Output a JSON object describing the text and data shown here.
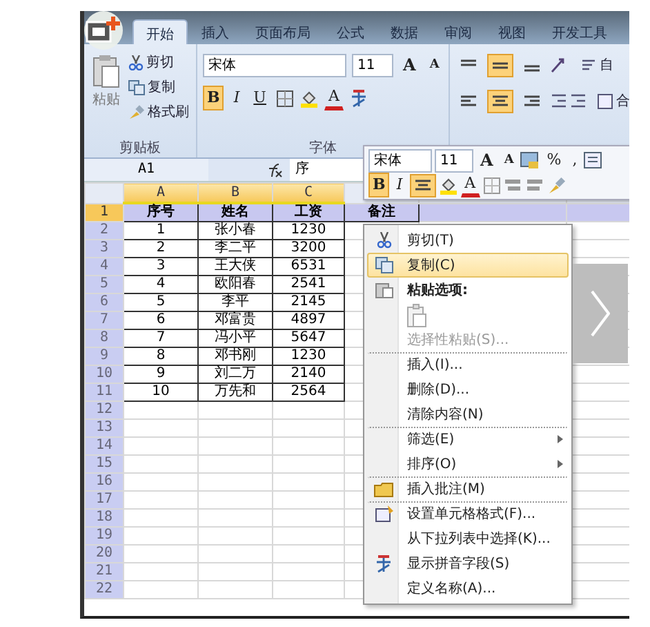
{
  "ribbon_tabs": [
    {
      "label": "开始",
      "selected": true
    },
    {
      "label": "插入",
      "selected": false
    },
    {
      "label": "页面布局",
      "selected": false
    },
    {
      "label": "公式",
      "selected": false
    },
    {
      "label": "数据",
      "selected": false
    },
    {
      "label": "审阅",
      "selected": false
    },
    {
      "label": "视图",
      "selected": false
    },
    {
      "label": "开发工具",
      "selected": false
    }
  ],
  "clipboard": {
    "paste": "粘贴",
    "cut": "剪切",
    "copy": "复制",
    "format_painter": "格式刷",
    "group_label": "剪贴板"
  },
  "font": {
    "name": "宋体",
    "size": "11",
    "grow": "A",
    "shrink": "A",
    "color_letter": "A",
    "group_label": "字体",
    "style_buttons": [
      {
        "glyph": "B",
        "selected": true
      },
      {
        "glyph": "I",
        "selected": false
      },
      {
        "glyph": "U",
        "selected": false
      }
    ]
  },
  "alignment": {
    "vertical": [
      {
        "selected": false
      },
      {
        "selected": true
      },
      {
        "selected": false
      }
    ],
    "horizontal": [
      {
        "selected": false
      },
      {
        "selected": true
      },
      {
        "selected": false
      }
    ],
    "wrap_text": "自",
    "merge": "合"
  },
  "name_box": "A1",
  "formula": "序",
  "columns": [
    {
      "label": "A",
      "selected": true
    },
    {
      "label": "B",
      "selected": true
    },
    {
      "label": "C",
      "selected": true
    }
  ],
  "rows": [
    {
      "number": "1",
      "selected": true,
      "cells": [
        "序号",
        "姓名",
        "工资",
        "备注"
      ]
    },
    {
      "number": "2",
      "selected": false,
      "cells": [
        "1",
        "张小春",
        "1230"
      ]
    },
    {
      "number": "3",
      "selected": false,
      "cells": [
        "2",
        "李二平",
        "3200"
      ]
    },
    {
      "number": "4",
      "selected": false,
      "cells": [
        "3",
        "王大侠",
        "6531"
      ]
    },
    {
      "number": "5",
      "selected": false,
      "cells": [
        "4",
        "欧阳春",
        "2541"
      ]
    },
    {
      "number": "6",
      "selected": false,
      "cells": [
        "5",
        "李平",
        "2145"
      ]
    },
    {
      "number": "7",
      "selected": false,
      "cells": [
        "6",
        "邓富贵",
        "4897"
      ]
    },
    {
      "number": "8",
      "selected": false,
      "cells": [
        "7",
        "冯小平",
        "5647"
      ]
    },
    {
      "number": "9",
      "selected": false,
      "cells": [
        "8",
        "邓书刚",
        "1230"
      ]
    },
    {
      "number": "10",
      "selected": false,
      "cells": [
        "9",
        "刘二万",
        "2140"
      ]
    },
    {
      "number": "11",
      "selected": false,
      "cells": [
        "10",
        "万先和",
        "2564"
      ]
    },
    {
      "number": "12",
      "selected": false,
      "cells": []
    },
    {
      "number": "13",
      "selected": false,
      "cells": []
    },
    {
      "number": "14",
      "selected": false,
      "cells": []
    },
    {
      "number": "15",
      "selected": false,
      "cells": []
    },
    {
      "number": "16",
      "selected": false,
      "cells": []
    },
    {
      "number": "17",
      "selected": false,
      "cells": []
    },
    {
      "number": "18",
      "selected": false,
      "cells": []
    },
    {
      "number": "19",
      "selected": false,
      "cells": []
    },
    {
      "number": "20",
      "selected": false,
      "cells": []
    },
    {
      "number": "21",
      "selected": false,
      "cells": []
    },
    {
      "number": "22",
      "selected": false,
      "cells": []
    }
  ],
  "mini_toolbar": {
    "font": "宋体",
    "size": "11",
    "grow": "A",
    "shrink": "A",
    "percent": "%",
    "comma": ",",
    "color_letter": "A",
    "style_buttons": [
      {
        "glyph": "B",
        "selected": true
      },
      {
        "glyph": "I",
        "selected": false
      }
    ],
    "center_selected": true
  },
  "context_menu": [
    {
      "kind": "command",
      "label": "剪切(T)",
      "selected": false,
      "disabled": false,
      "submenu": false,
      "separator_above": false
    },
    {
      "kind": "command",
      "label": "复制(C)",
      "selected": true,
      "disabled": false,
      "submenu": false,
      "separator_above": false
    },
    {
      "kind": "heading",
      "label": "粘贴选项:",
      "selected": false,
      "disabled": false,
      "submenu": false,
      "separator_above": false
    },
    {
      "kind": "paste-option",
      "selected": false,
      "disabled": false,
      "submenu": false,
      "separator_above": false
    },
    {
      "kind": "command",
      "label": "选择性粘贴(S)...",
      "selected": false,
      "disabled": true,
      "submenu": false,
      "separator_above": false
    },
    {
      "kind": "command",
      "label": "插入(I)...",
      "selected": false,
      "disabled": false,
      "submenu": false,
      "separator_above": true
    },
    {
      "kind": "command",
      "label": "删除(D)...",
      "selected": false,
      "disabled": false,
      "submenu": false,
      "separator_above": false
    },
    {
      "kind": "command",
      "label": "清除内容(N)",
      "selected": false,
      "disabled": false,
      "submenu": false,
      "separator_above": false
    },
    {
      "kind": "command",
      "label": "筛选(E)",
      "selected": false,
      "disabled": false,
      "submenu": true,
      "separator_above": true
    },
    {
      "kind": "command",
      "label": "排序(O)",
      "selected": false,
      "disabled": false,
      "submenu": true,
      "separator_above": false
    },
    {
      "kind": "command",
      "label": "插入批注(M)",
      "selected": false,
      "disabled": false,
      "submenu": false,
      "separator_above": true
    },
    {
      "kind": "command",
      "label": "设置单元格格式(F)...",
      "selected": false,
      "disabled": false,
      "submenu": false,
      "separator_above": true
    },
    {
      "kind": "command",
      "label": "从下拉列表中选择(K)...",
      "selected": false,
      "disabled": false,
      "submenu": false,
      "separator_above": false
    },
    {
      "kind": "command",
      "label": "显示拼音字段(S)",
      "selected": false,
      "disabled": false,
      "submenu": false,
      "separator_above": false
    },
    {
      "kind": "command",
      "label": "定义名称(A)...",
      "selected": false,
      "disabled": false,
      "submenu": false,
      "separator_above": false
    }
  ]
}
